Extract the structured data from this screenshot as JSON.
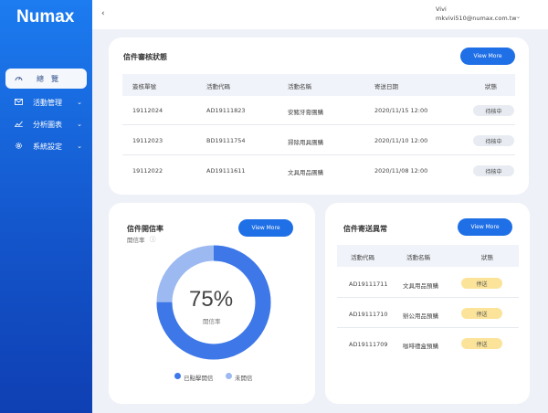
{
  "app": {
    "logo": "Numax"
  },
  "sidebar": {
    "items": [
      {
        "label": "總　覽",
        "icon": "gauge-icon",
        "active": true
      },
      {
        "label": "活動管理",
        "icon": "mail-icon",
        "chevron": "⌄"
      },
      {
        "label": "分析圖表",
        "icon": "chart-icon",
        "chevron": "⌄"
      },
      {
        "label": "系統設定",
        "icon": "gear-icon",
        "chevron": "⌄"
      }
    ]
  },
  "topbar": {
    "back": "‹",
    "user_name": "Vivi",
    "user_email": "mkvivi510@numax.com.tw",
    "caret": "⌄"
  },
  "review": {
    "title": "信件審核狀態",
    "button": "View More",
    "columns": [
      "簽核單號",
      "活動代碼",
      "活動名稱",
      "寄送日期",
      "狀態"
    ],
    "rows": [
      [
        "19112024",
        "AD19111823",
        "安豬牙膏團購",
        "2020/11/15 12:00",
        "待核中"
      ],
      [
        "19112023",
        "BD19111754",
        "掃除用具團購",
        "2020/11/10 12:00",
        "待核中"
      ],
      [
        "19112022",
        "AD19111611",
        "文具用品團購",
        "2020/11/08 12:00",
        "待核中"
      ]
    ]
  },
  "open_rate": {
    "title": "信件開信率",
    "subtitle": "開信率",
    "info_icon": "ⓘ",
    "button": "View More",
    "percent": "75%",
    "percent_label": "開信率",
    "value": 75,
    "colors": {
      "opened": "#3d77e8",
      "unopened": "#9cb9f2"
    },
    "legend": [
      "已點擊開信",
      "未開信"
    ]
  },
  "anomaly": {
    "title": "信件寄送異常",
    "button": "View More",
    "columns": [
      "活動代碼",
      "活動名稱",
      "狀態"
    ],
    "rows": [
      [
        "AD19111711",
        "文具用品預購",
        "停送"
      ],
      [
        "AD19111710",
        "辦公用品預購",
        "停送"
      ],
      [
        "AD19111709",
        "咖啡禮盒預購",
        "停送"
      ]
    ]
  }
}
